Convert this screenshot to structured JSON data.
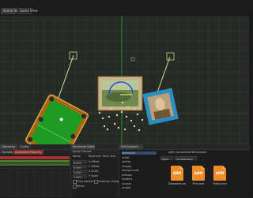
{
  "tabs": [
    {
      "label": "Scene View"
    },
    {
      "label": "Game View"
    }
  ],
  "viewport": {
    "grid": true,
    "accent_axis_color": "#33aa33",
    "selection_color": "#e9d6a0"
  },
  "panels": {
    "timeline": {
      "tabs": [
        "Hierarchy",
        "Config"
      ],
      "subtabs": [
        "Transform",
        "Animated Property"
      ],
      "track_colors": [
        "#a5342f",
        "#4f7c3e",
        "#3b6b2e"
      ]
    },
    "sprite_editor": {
      "tabs": [
        "Keyframe Editor",
        "Sprite Frames"
      ],
      "header_labels": [
        "Name",
        "Keyframe Time (ms)"
      ],
      "fields": [
        {
          "label": "X Offset",
          "value": "0.000"
        },
        {
          "label": "Y Offset",
          "value": "0.000"
        },
        {
          "label": "X Scale",
          "value": "1.000"
        },
        {
          "label": "Y Scale",
          "value": "1.000"
        }
      ],
      "checkboxes": [
        "Pixel perfect",
        "Instantly change",
        "Mirror"
      ],
      "extra_rows": [
        "Row 1",
        "Row 2"
      ]
    },
    "file_explorer": {
      "tab": "File Explorer",
      "tree": [
        "animation",
        "script",
        "sprites",
        "images",
        "backgrounds",
        "prefabs",
        "shaders",
        "sounds",
        "scripts"
      ],
      "path": "/project/fwFileExample",
      "back_label": "Back",
      "up_label": "Up directory",
      "files": [
        {
          "icon": "ANM",
          "name": "Diceworm.anm"
        },
        {
          "icon": "ANM",
          "name": "Fire.anm"
        },
        {
          "icon": "ANM",
          "name": "Trails.anm"
        }
      ]
    }
  }
}
